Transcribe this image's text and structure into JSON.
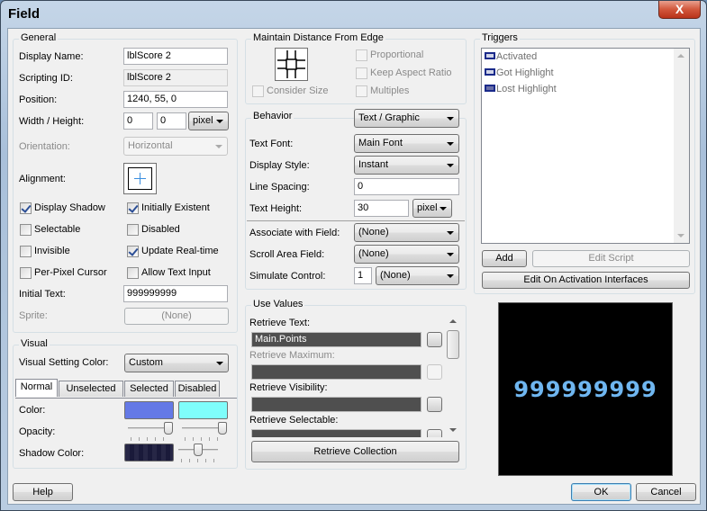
{
  "window": {
    "title": "Field",
    "close_glyph": "X"
  },
  "general": {
    "label": "General",
    "display_name": {
      "label": "Display Name:",
      "value": "lblScore 2"
    },
    "scripting_id": {
      "label": "Scripting ID:",
      "value": "lblScore 2"
    },
    "position": {
      "label": "Position:",
      "value": "1240, 55, 0"
    },
    "width_height": {
      "label": "Width / Height:",
      "width": "0",
      "height": "0",
      "unit": "pixel"
    },
    "orientation": {
      "label": "Orientation:",
      "value": "Horizontal"
    },
    "alignment": {
      "label": "Alignment:"
    },
    "checkboxes": [
      {
        "label": "Display Shadow",
        "checked": true
      },
      {
        "label": "Initially Existent",
        "checked": true
      },
      {
        "label": "Selectable",
        "checked": false
      },
      {
        "label": "Disabled",
        "checked": false
      },
      {
        "label": "Invisible",
        "checked": false
      },
      {
        "label": "Update Real-time",
        "checked": true
      },
      {
        "label": "Per-Pixel Cursor",
        "checked": false
      },
      {
        "label": "Allow Text Input",
        "checked": false
      }
    ],
    "initial_text": {
      "label": "Initial Text:",
      "value": "999999999"
    },
    "sprite": {
      "label": "Sprite:",
      "value": "(None)"
    }
  },
  "visual": {
    "label": "Visual",
    "setting_color": {
      "label": "Visual Setting Color:",
      "value": "Custom"
    },
    "tabs": [
      "Normal",
      "Unselected",
      "Selected",
      "Disabled"
    ],
    "active_tab": "Normal",
    "color": {
      "label": "Color:",
      "primary": "#6479e6",
      "secondary": "#7ffdfb"
    },
    "opacity": {
      "label": "Opacity:",
      "primary": 1.0,
      "secondary": 1.0
    },
    "shadow_color": {
      "label": "Shadow Color:",
      "color": "#1a1a3a",
      "opacity": 0.5
    }
  },
  "edge": {
    "label": "Maintain Distance From Edge",
    "consider_size": "Consider Size",
    "proportional": "Proportional",
    "keep_aspect": "Keep Aspect Ratio",
    "multiples": "Multiples"
  },
  "behavior": {
    "label": "Behavior",
    "type": "Text / Graphic",
    "text_font": {
      "label": "Text Font:",
      "value": "Main Font"
    },
    "display_style": {
      "label": "Display Style:",
      "value": "Instant"
    },
    "line_spacing": {
      "label": "Line Spacing:",
      "value": "0"
    },
    "text_height": {
      "label": "Text Height:",
      "value": "30",
      "unit": "pixel"
    },
    "associate": {
      "label": "Associate with Field:",
      "value": "(None)"
    },
    "scroll_area": {
      "label": "Scroll Area Field:",
      "value": "(None)"
    },
    "simulate": {
      "label": "Simulate Control:",
      "number": "1",
      "value": "(None)"
    }
  },
  "use_values": {
    "label": "Use Values",
    "items": [
      {
        "label": "Retrieve Text:",
        "value": "Main.Points",
        "enabled": true
      },
      {
        "label": "Retrieve Maximum:",
        "value": "",
        "enabled": false
      },
      {
        "label": "Retrieve Visibility:",
        "value": "",
        "enabled": true
      },
      {
        "label": "Retrieve Selectable:",
        "value": "",
        "enabled": true
      }
    ],
    "collection_button": "Retrieve Collection"
  },
  "triggers": {
    "label": "Triggers",
    "items": [
      "Activated",
      "Got Highlight",
      "Lost Highlight"
    ],
    "add": "Add",
    "edit_script": "Edit Script",
    "edit_interfaces": "Edit On Activation Interfaces"
  },
  "preview": {
    "text": "999999999",
    "text_color": "#6fb6f0"
  },
  "footer": {
    "help": "Help",
    "ok": "OK",
    "cancel": "Cancel"
  }
}
